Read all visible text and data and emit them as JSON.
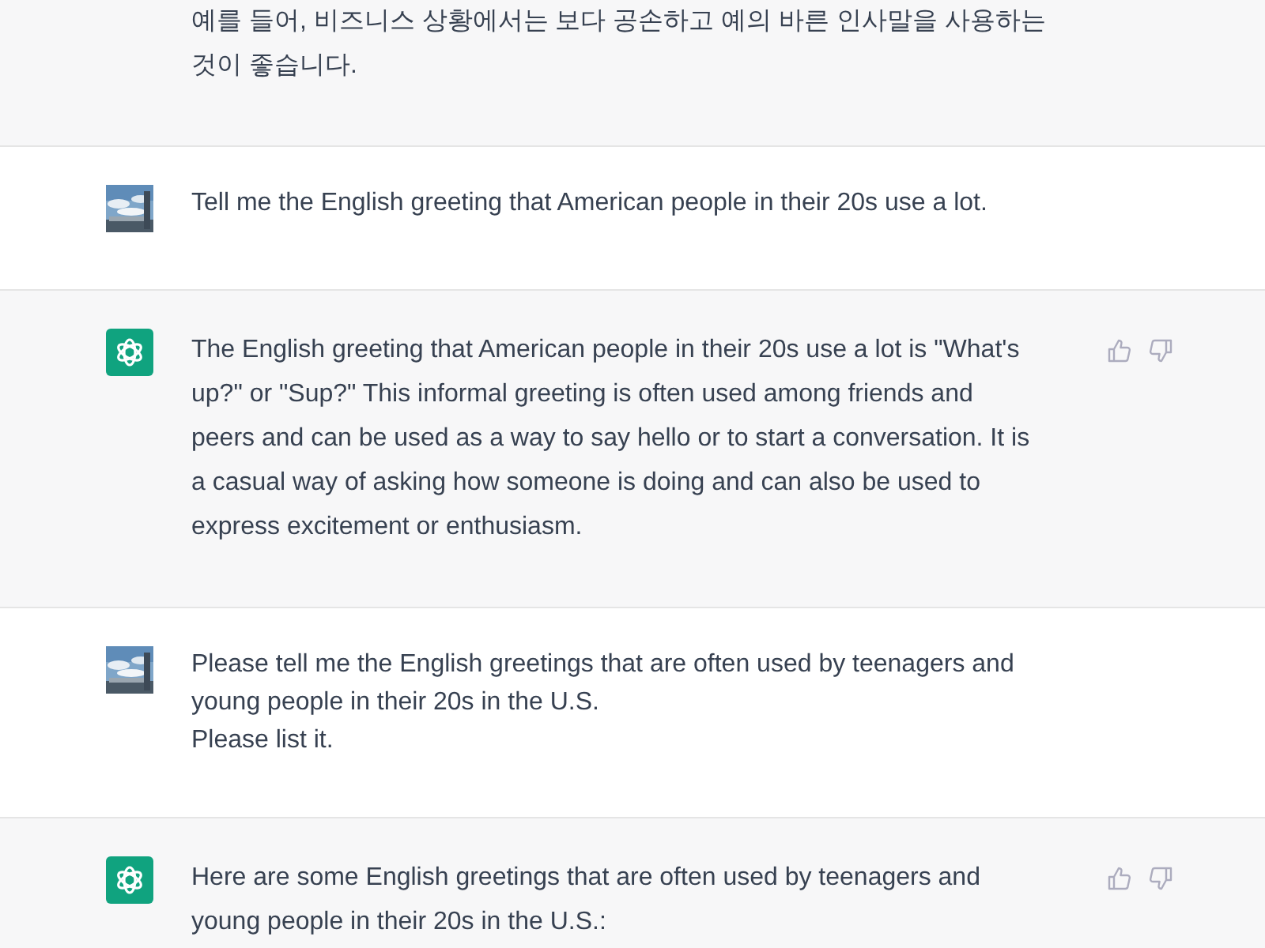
{
  "messages": [
    {
      "kind": "assistant",
      "top_cut": true,
      "lines": [
        "예를 들어, 비즈니스 상황에서는 보다 공손하고 예의 바른 인사말을 사용하는",
        "것이 좋습니다."
      ]
    },
    {
      "kind": "user",
      "lines": [
        "Tell me the English greeting that American people in their 20s use a lot."
      ]
    },
    {
      "kind": "assistant",
      "lines": [
        "The English greeting that American people in their 20s use a lot is \"What's",
        "up?\" or \"Sup?\" This informal greeting is often used among friends and",
        "peers and can be used as a way to say hello or to start a conversation. It is",
        "a casual way of asking how someone is doing and can also be used to",
        "express excitement or enthusiasm."
      ]
    },
    {
      "kind": "user",
      "lines": [
        "Please tell me the English greetings that are often used by teenagers and",
        "young people in their 20s in the U.S.",
        "Please list it."
      ]
    },
    {
      "kind": "assistant",
      "lines": [
        "Here are some English greetings that are often used by teenagers and",
        "young people in their 20s in the U.S.:"
      ]
    }
  ]
}
